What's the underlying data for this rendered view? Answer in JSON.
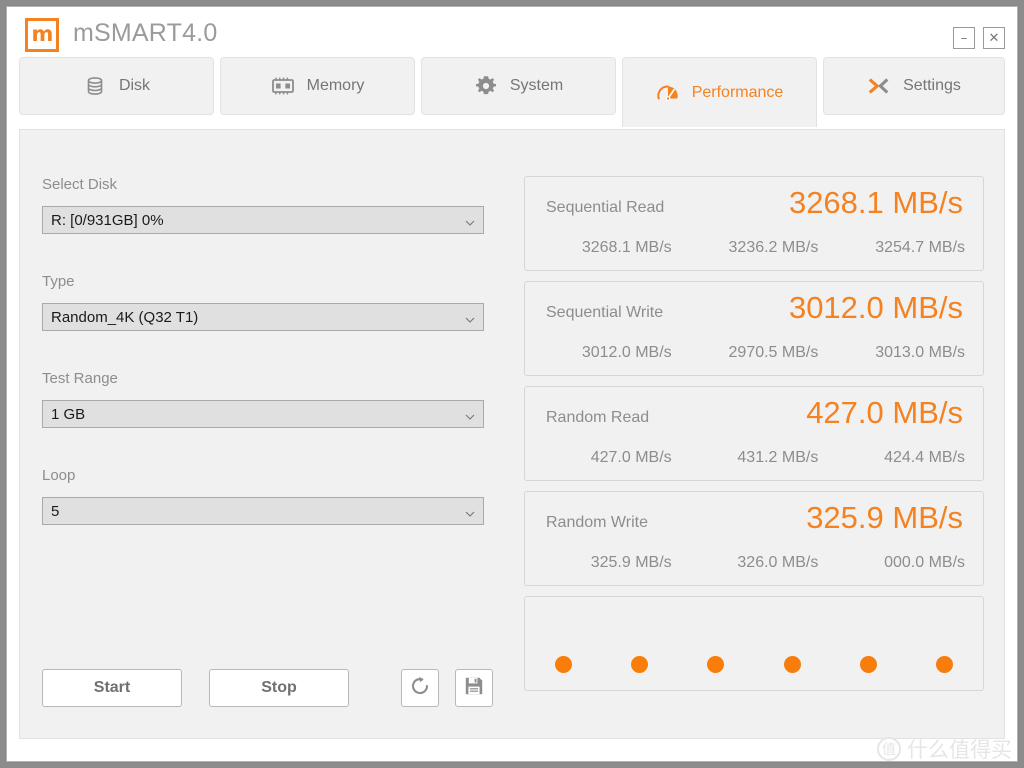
{
  "window": {
    "logo_glyph": "m",
    "title": "mSMART4.0",
    "minimize_label": "–",
    "close_label": "✕"
  },
  "tabs": [
    {
      "id": "disk",
      "label": "Disk",
      "icon": "disk-icon",
      "active": false
    },
    {
      "id": "memory",
      "label": "Memory",
      "icon": "memory-icon",
      "active": false
    },
    {
      "id": "system",
      "label": "System",
      "icon": "gear-icon",
      "active": false
    },
    {
      "id": "performance",
      "label": "Performance",
      "icon": "speedometer-icon",
      "active": true
    },
    {
      "id": "settings",
      "label": "Settings",
      "icon": "chevrons-icon",
      "active": false
    }
  ],
  "form": {
    "select_disk": {
      "label": "Select Disk",
      "value": "R: [0/931GB] 0%"
    },
    "type": {
      "label": "Type",
      "value": "Random_4K (Q32 T1)"
    },
    "test_range": {
      "label": "Test Range",
      "value": "1 GB"
    },
    "loop": {
      "label": "Loop",
      "value": "5"
    }
  },
  "actions": {
    "start_label": "Start",
    "stop_label": "Stop",
    "refresh_icon": "refresh-icon",
    "save_icon": "save-icon"
  },
  "results": [
    {
      "label": "Sequential Read",
      "main": "3268.1 MB/s",
      "runs": [
        "3268.1 MB/s",
        "3236.2 MB/s",
        "3254.7 MB/s"
      ]
    },
    {
      "label": "Sequential Write",
      "main": "3012.0 MB/s",
      "runs": [
        "3012.0 MB/s",
        "2970.5 MB/s",
        "3013.0 MB/s"
      ]
    },
    {
      "label": "Random Read",
      "main": "427.0 MB/s",
      "runs": [
        "427.0 MB/s",
        "431.2 MB/s",
        "424.4 MB/s"
      ]
    },
    {
      "label": "Random Write",
      "main": "325.9 MB/s",
      "runs": [
        "325.9 MB/s",
        "326.0 MB/s",
        "000.0 MB/s"
      ]
    }
  ],
  "progress": {
    "dot_count": 6,
    "dot_color": "#f97d0a"
  },
  "watermark": {
    "badge": "值",
    "text": "什么值得买"
  },
  "colors": {
    "accent": "#f58220",
    "panel": "#f1f1f1",
    "text_muted": "#8d8d8d",
    "window_bg": "#ffffff"
  }
}
